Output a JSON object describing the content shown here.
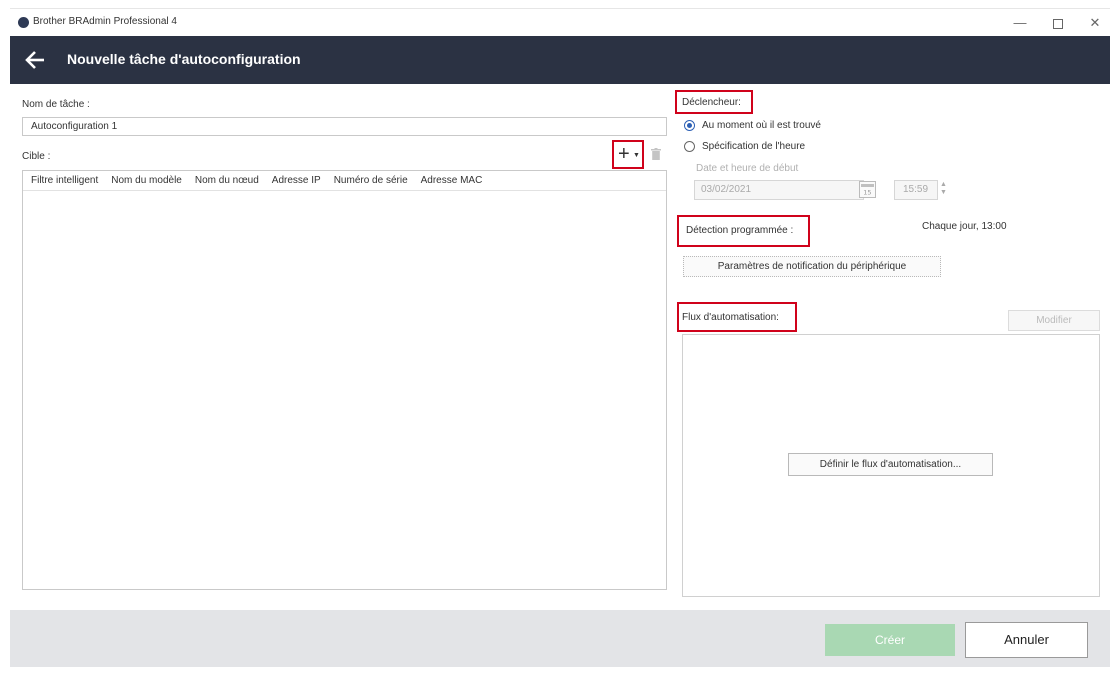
{
  "window": {
    "title": "Brother BRAdmin Professional 4",
    "minimize": "—",
    "close": "✕"
  },
  "header": {
    "title": "Nouvelle tâche d'autoconfiguration"
  },
  "task": {
    "name_label": "Nom de tâche :",
    "name_value": "Autoconfiguration 1"
  },
  "target": {
    "label": "Cible :",
    "columns": [
      "Filtre intelligent",
      "Nom du modèle",
      "Nom du nœud",
      "Adresse IP",
      "Numéro de série",
      "Adresse MAC"
    ]
  },
  "trigger": {
    "label": "Déclencheur:",
    "option_found": "Au moment où il est trouvé",
    "option_time": "Spécification de l'heure",
    "selected": "found",
    "start_label": "Date et heure de début",
    "date_value": "03/02/2021",
    "time_value": "15:59",
    "calendar_day": "15"
  },
  "detection": {
    "label": "Détection programmée :",
    "schedule": "Chaque jour, 13:00",
    "notify_button": "Paramètres de notification du périphérique"
  },
  "flow": {
    "label": "Flux d'automatisation:",
    "modify_button": "Modifier",
    "define_button": "Définir le flux d'automatisation..."
  },
  "footer": {
    "create_button": "Créer",
    "cancel_button": "Annuler"
  },
  "colors": {
    "header_bg": "#2b3243",
    "highlight": "#d0021b",
    "create_bg": "#a9d8b3",
    "footer_bg": "#e3e4e7"
  }
}
